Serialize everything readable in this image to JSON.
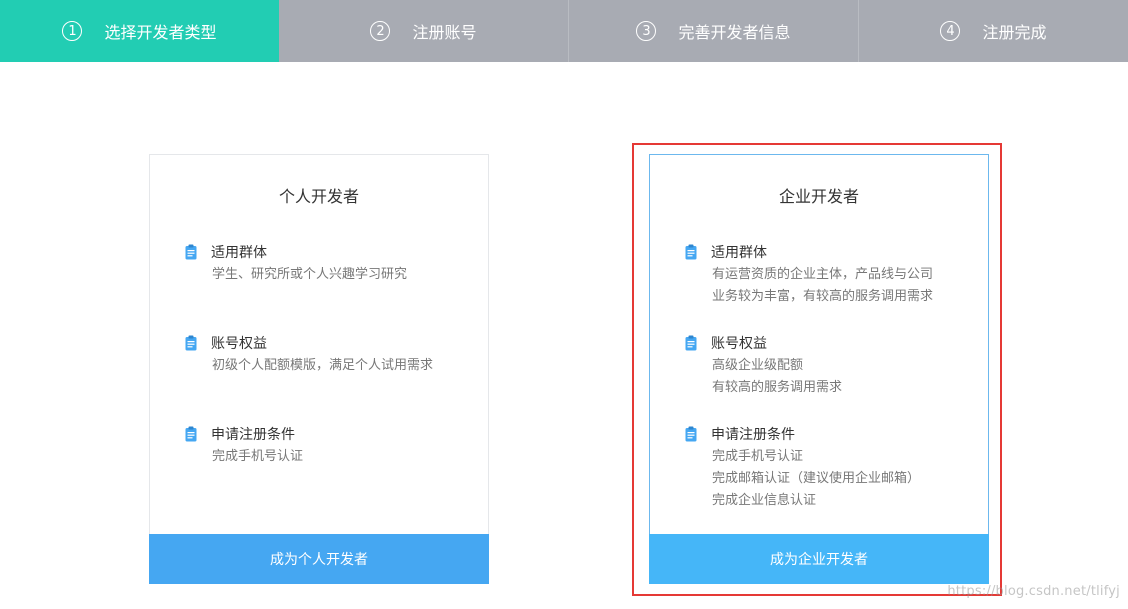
{
  "steps": [
    {
      "num": "1",
      "label": "选择开发者类型",
      "active": true
    },
    {
      "num": "2",
      "label": "注册账号",
      "active": false
    },
    {
      "num": "3",
      "label": "完善开发者信息",
      "active": false
    },
    {
      "num": "4",
      "label": "注册完成",
      "active": false
    }
  ],
  "personal": {
    "title": "个人开发者",
    "sections": [
      {
        "heading": "适用群体",
        "lines": [
          "学生、研究所或个人兴趣学习研究"
        ]
      },
      {
        "heading": "账号权益",
        "lines": [
          "初级个人配额模版，满足个人试用需求"
        ]
      },
      {
        "heading": "申请注册条件",
        "lines": [
          "完成手机号认证"
        ]
      }
    ],
    "button": "成为个人开发者"
  },
  "enterprise": {
    "title": "企业开发者",
    "sections": [
      {
        "heading": "适用群体",
        "lines": [
          "有运营资质的企业主体，产品线与公司",
          "业务较为丰富，有较高的服务调用需求"
        ]
      },
      {
        "heading": "账号权益",
        "lines": [
          "高级企业级配额",
          "有较高的服务调用需求"
        ]
      },
      {
        "heading": "申请注册条件",
        "lines": [
          "完成手机号认证",
          "完成邮箱认证（建议使用企业邮箱）",
          "完成企业信息认证"
        ]
      }
    ],
    "button": "成为企业开发者"
  },
  "watermark": "https://blog.csdn.net/tlifyj",
  "colors": {
    "active_step": "#22cdb3",
    "inactive_step": "#a8abb3",
    "button_personal": "#45a7f2",
    "button_enterprise": "#45b6f8",
    "icon": "#45a7f2",
    "highlight": "#e53935"
  },
  "icons": {
    "section": "clipboard-icon"
  }
}
